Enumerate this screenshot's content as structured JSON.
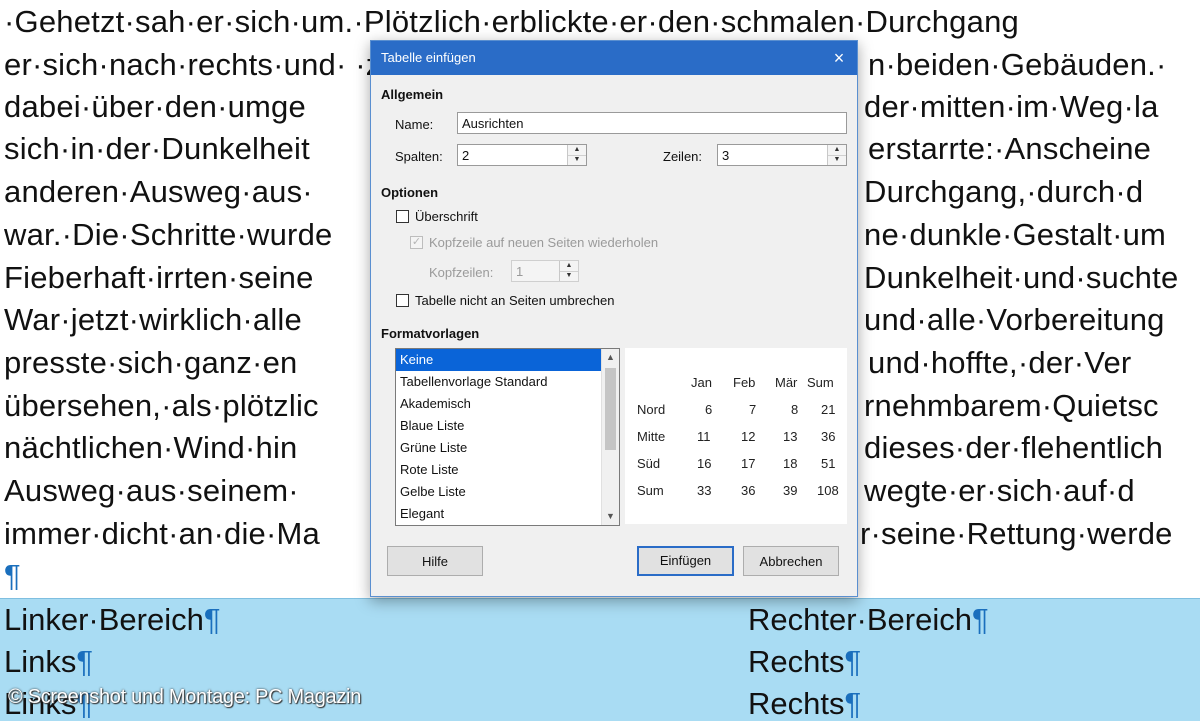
{
  "document": {
    "lines": [
      "·Gehetzt·sah·er·sich·um.·Plötzlich·erblickte·er·den·schmalen·Durchgang",
      "er·sich·nach·rechts·und·                                       ·zwischen·den·beiden·Gebäuden.·",
      "dabei·über·den·umge",
      "sich·in·der·Dunkelheit",
      "anderen·Ausweg·aus·",
      "war.·Die·Schritte·wurde",
      "Fieberhaft·irrten·seine",
      "War·jetzt·wirklich·alle",
      "presste·sich·ganz·en",
      "übersehen,·als·plötzlic",
      "nächtlichen·Wind·hin",
      "Ausweg·aus·seinem·",
      "immer·dicht·an·die·Ma"
    ],
    "lines_right": [
      "n·beiden·Gebäuden.·",
      "der·mitten·im·Weg·la",
      "erstarrte:·Anscheine",
      "Durchgang,·durch·d",
      "ne·dunkle·Gestalt·um",
      "Dunkelheit·und·suchte",
      "und·alle·Vorbereitung",
      "und·hoffte,·der·Ver",
      "rnehmbarem·Quietsc",
      "dieses·der·flehentlich",
      "wegte·er·sich·auf·d",
      "r·seine·Rettung·werde"
    ],
    "pilcrow": "¶",
    "table": {
      "left": [
        "Linker·Bereich",
        "Links",
        "Links"
      ],
      "right": [
        "Rechter·Bereich",
        "Rechts",
        "Rechts"
      ]
    },
    "watermark": "© Screenshot und Montage: PC Magazin"
  },
  "dialog": {
    "title": "Tabelle einfügen",
    "close_icon": "×",
    "general_section": "Allgemein",
    "name_label": "Name:",
    "name_value": "Ausrichten",
    "columns_label": "Spalten:",
    "columns_value": "2",
    "rows_label": "Zeilen:",
    "rows_value": "3",
    "options_section": "Optionen",
    "heading_label": "Überschrift",
    "repeat_label": "Kopfzeile auf neuen Seiten wiederholen",
    "header_rows_label": "Kopfzeilen:",
    "header_rows_value": "1",
    "no_split_label": "Tabelle nicht an Seiten umbrechen",
    "styles_section": "Formatvorlagen",
    "styles": [
      "Keine",
      "Tabellenvorlage Standard",
      "Akademisch",
      "Blaue Liste",
      "Grüne Liste",
      "Rote Liste",
      "Gelbe Liste",
      "Elegant"
    ],
    "selected_style": "Keine",
    "preview": {
      "headers": [
        "Jan",
        "Feb",
        "Mär",
        "Sum"
      ],
      "rows": [
        {
          "label": "Nord",
          "values": [
            "6",
            "7",
            "8",
            "21"
          ]
        },
        {
          "label": "Mitte",
          "values": [
            "11",
            "12",
            "13",
            "36"
          ]
        },
        {
          "label": "Süd",
          "values": [
            "16",
            "17",
            "18",
            "51"
          ]
        },
        {
          "label": "Sum",
          "values": [
            "33",
            "36",
            "39",
            "108"
          ]
        }
      ]
    },
    "help_button": "Hilfe",
    "insert_button": "Einfügen",
    "cancel_button": "Abbrechen"
  },
  "colors": {
    "titlebar": "#2a6cc7",
    "selection": "#0a64d8",
    "table_fill": "#a9dcf3",
    "pilcrow": "#1a6fbd"
  }
}
